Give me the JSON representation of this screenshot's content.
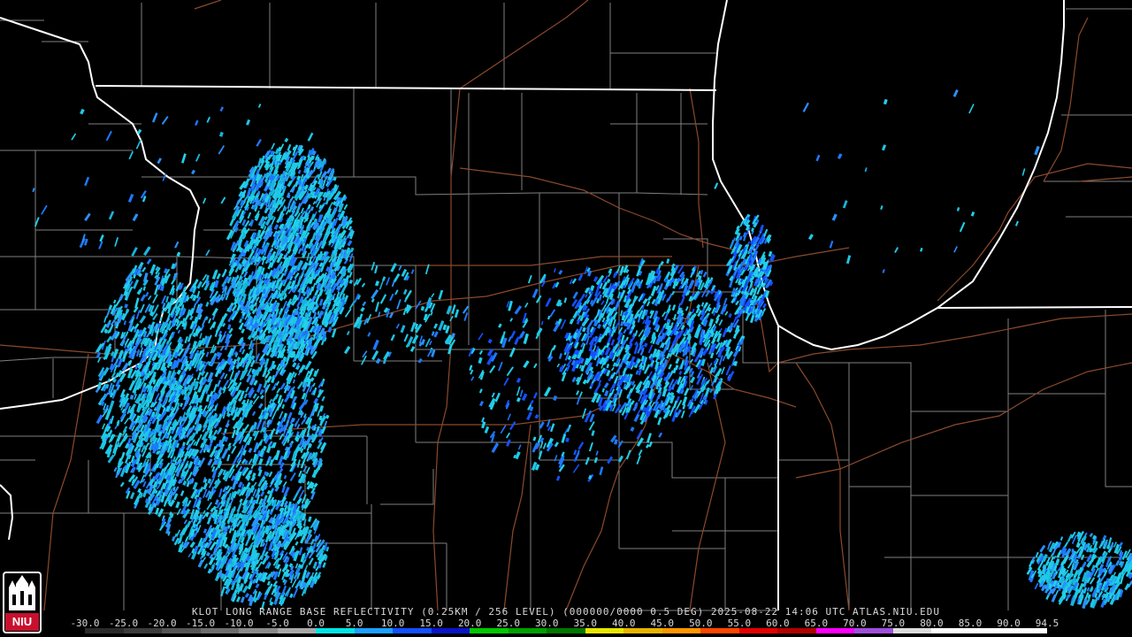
{
  "title": "KLOT LONG RANGE BASE REFLECTIVITY (0.25KM / 256 LEVEL) (000000/0000 0.5 DEG) 2025-08-22 14:06 UTC  ATLAS.NIU.EDU",
  "logo_text": "NIU",
  "scale": {
    "labels": [
      "-30.0",
      "-25.0",
      "-20.0",
      "-15.0",
      "-10.0",
      "-5.0",
      "0.0",
      "5.0",
      "10.0",
      "15.0",
      "20.0",
      "25.0",
      "30.0",
      "35.0",
      "40.0",
      "45.0",
      "50.0",
      "55.0",
      "60.0",
      "65.0",
      "70.0",
      "75.0",
      "80.0",
      "85.0",
      "90.0",
      "94.5"
    ],
    "colors": [
      "#2b2b2b",
      "#3d3d3d",
      "#555555",
      "#6e6e6e",
      "#8a8a8a",
      "#a8a8a8",
      "#00e5e5",
      "#1ca0ff",
      "#1450ff",
      "#0a14c8",
      "#00c800",
      "#00a000",
      "#007800",
      "#e6e600",
      "#e6b400",
      "#ff9600",
      "#ff4600",
      "#e60000",
      "#b40000",
      "#ff00ff",
      "#a050dc",
      "#dcdcdc",
      "#ffffff",
      "#ffffff",
      "#ffffff"
    ]
  },
  "colors": {
    "background": "#000000",
    "state_border": "#ffffff",
    "county_border": "#8a8a8a",
    "road": "#8b4a2b",
    "echo_primary": "#1ec8e6",
    "echo_secondary": "#1e78ff"
  }
}
